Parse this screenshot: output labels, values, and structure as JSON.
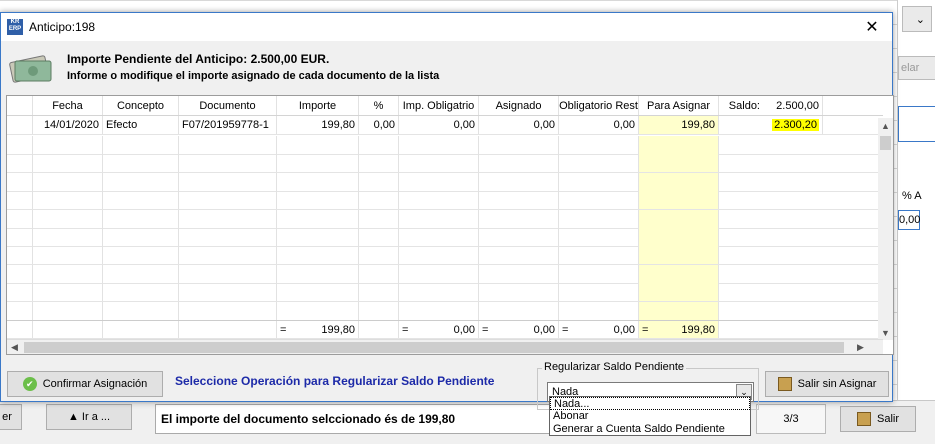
{
  "background": {
    "bottom_left_button": "er",
    "goto_button": "▲ Ir a ...",
    "status_message": "El importe del documento selccionado és de 199,80",
    "page_counter": "3/3",
    "exit_button": "Salir",
    "right_label_1": "elar",
    "right_label_2": "% A",
    "right_value": "0,00"
  },
  "dialog": {
    "title": "Anticipo:198",
    "icon_text": "KR ERP",
    "info_line1": "Importe Pendiente del Anticipo: 2.500,00 EUR.",
    "info_line2": "Informe o modifique el importe asignado de cada documento de la lista",
    "columns": [
      "Fecha",
      "Concepto",
      "Documento",
      "Importe",
      "%",
      "Imp. Obligatrio",
      "Asignado",
      "Obligatorio Rest",
      "Para Asignar",
      "Saldo:",
      "2.500,00"
    ],
    "rows": [
      {
        "fecha": "14/01/2020",
        "concepto": "Efecto",
        "documento": "F07/201959778-1",
        "importe": "199,80",
        "pct": "0,00",
        "imp_obligatorio": "0,00",
        "asignado": "0,00",
        "obligatorio_rest": "0,00",
        "para_asignar": "199,80",
        "saldo": "2.300,20"
      }
    ],
    "totals": {
      "eq1": "=",
      "importe": "199,80",
      "eq2": "=",
      "imp_obligatorio": "0,00",
      "eq3": "=",
      "asignado": "0,00",
      "eq4": "=",
      "obligatorio_rest": "0,00",
      "eq5": "=",
      "para_asignar": "199,80"
    },
    "confirm_button": "Confirmar Asignación",
    "hint": "Seleccione Operación para Regularizar Saldo Pendiente",
    "group_label": "Regularizar Saldo Pendiente",
    "select_value": "Nada",
    "options": [
      "Nada...",
      "Abonar",
      "Generar a Cuenta Saldo Pendiente"
    ],
    "exit_no_assign_button": "Salir sin Asignar"
  },
  "colors": {
    "highlight": "#ffff00",
    "para_asignar_bg": "#ffffcc",
    "hint_text": "#1d2aa8"
  }
}
